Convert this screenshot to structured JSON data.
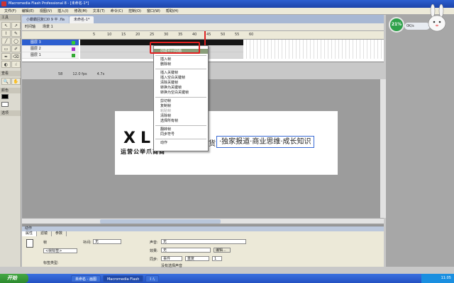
{
  "window": {
    "title": "Macromedia Flash Professional 8 - [未命名-1*]"
  },
  "menubar": [
    "文件(F)",
    "编辑(E)",
    "视图(V)",
    "插入(I)",
    "修改(M)",
    "文本(T)",
    "命令(C)",
    "控制(O)",
    "窗口(W)",
    "帮助(H)"
  ],
  "tools": {
    "header": "工具",
    "items": [
      "↖",
      "↗",
      "⌇",
      "✎",
      "╱",
      "◯",
      "▭",
      "✐",
      "✒",
      "⌫",
      "◐",
      "☝",
      "🔍",
      "✋"
    ],
    "view_label": "查看",
    "color_label": "颜色",
    "options_label": "选项"
  },
  "doc_tabs": [
    "小霸霸回复口0 9 平 .fla",
    "未命名-1*"
  ],
  "scene": {
    "timeline_label": "时间轴",
    "scene_label": "场景 1"
  },
  "timeline": {
    "ruler": [
      "5",
      "10",
      "15",
      "20",
      "25",
      "30",
      "35",
      "40",
      "45",
      "50",
      "55",
      "60"
    ],
    "layers": [
      "图层 3",
      "图层 2",
      "图层 1"
    ],
    "status": [
      "58",
      "12.0 fps",
      "4.7s"
    ]
  },
  "context_menu": {
    "items": [
      "创建补间动画",
      "插入帧",
      "删除帧",
      "插入关键帧",
      "插入空白关键帧",
      "清除关键帧",
      "转换为关键帧",
      "转换为空白关键帧",
      "剪切帧",
      "复制帧",
      "粘贴帧",
      "清除帧",
      "选择所有帧",
      "翻转帧",
      "同步符号",
      "动作"
    ],
    "highlighted": "创建补间动画",
    "disabled": [
      "粘贴帧"
    ]
  },
  "stage": {
    "logo": "XLI",
    "logo_sub": "运营公举爪商商",
    "slogan_prefix": "干货",
    "slogan": "·独家报道·商业思维·成长知识"
  },
  "gadget": {
    "percent": "21%",
    "stat": "0K/s"
  },
  "properties": {
    "title": "动作",
    "tabs": [
      "属性",
      "滤镜",
      "参数"
    ],
    "frame_label": "帧",
    "frame_name_placeholder": "<帧标签>",
    "label_type": "标签类型:",
    "tween_label": "补间:",
    "tween_value": "无",
    "sound_label": "声音:",
    "sound_value": "无",
    "effect_label": "效果:",
    "effect_value": "无",
    "edit_label": "编辑...",
    "sync_label": "同步:",
    "sync_value": "事件",
    "repeat_value": "重复",
    "repeat_count": "1",
    "no_sound": "没有选择声音"
  },
  "taskbar": {
    "start": "开始",
    "tasks": [
      "未命名 - 画图",
      "Macromedia Flash",
      "I :\\"
    ],
    "time": "11:05"
  },
  "colors": {
    "accent": "#2d5fd0",
    "highlight": "#e02020"
  }
}
